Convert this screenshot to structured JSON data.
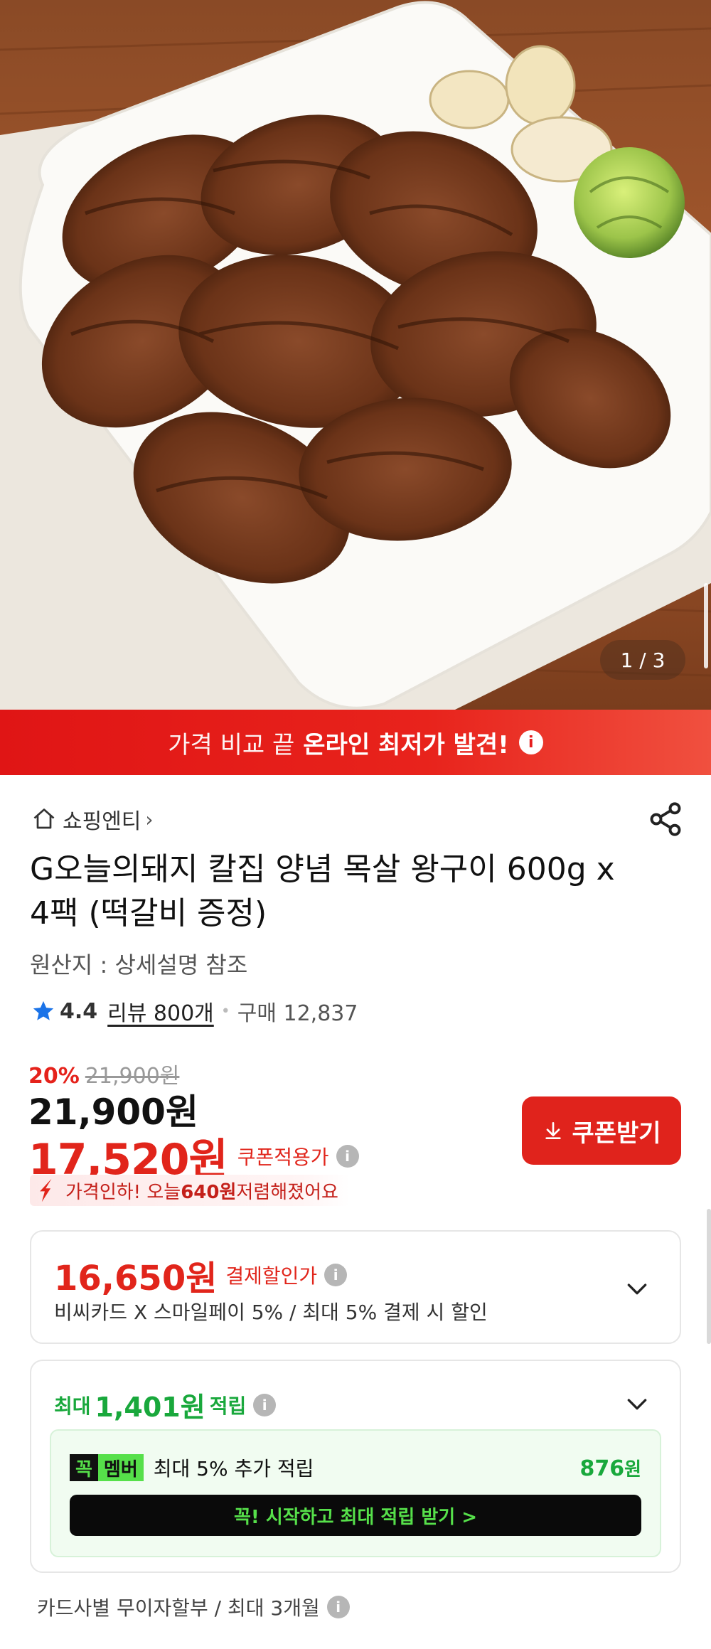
{
  "product_image": {
    "counter": "1 / 3",
    "alt_icon": "grilled-pork-photo"
  },
  "banner": {
    "prefix": "가격 비교 끝",
    "highlight": "온라인 최저가 발견!",
    "icon": "info-icon",
    "color": "#e51d1d"
  },
  "store": {
    "name": "쇼핑엔티",
    "chevron": "›"
  },
  "title": "G오늘의돼지 칼집 양념 목살 왕구이 600g x 4팩 (떡갈비 증정)",
  "origin": "원산지 : 상세설명 참조",
  "rating": {
    "score": "4.4",
    "reviews": "리뷰 800개",
    "purchases": "구매 12,837",
    "star_color": "#1a73e8"
  },
  "price": {
    "discount_rate": "20%",
    "original": "21,900",
    "original_unit": "원",
    "sale": "21,900원",
    "coupon_price": "17,520원",
    "coupon_label": "쿠폰적용가",
    "coupon_button": "쿠폰받기",
    "drop_text_pre": "가격인하! 오늘 ",
    "drop_amount": "640원",
    "drop_text_post": " 저렴해졌어요",
    "accent": "#e1251b"
  },
  "payment_discount": {
    "price": "16,650원",
    "label": "결제할인가",
    "desc": "비씨카드 X 스마일페이 5% / 최대 5% 결제 시 할인"
  },
  "points": {
    "prefix": "최대",
    "amount": "1,401원",
    "suffix": "적립",
    "color": "#19a83c",
    "member": {
      "badge_left": "꼭",
      "badge_right": "멤버",
      "text": "최대 5% 추가 적립",
      "points": "876",
      "points_unit": "원",
      "button": "꼭! 시작하고 최대 적립 받기  >"
    }
  },
  "installment": "카드사별 무이자할부 / 최대 3개월"
}
